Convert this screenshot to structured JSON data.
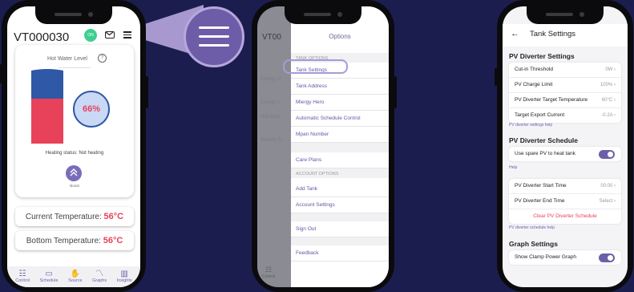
{
  "phone1": {
    "device_id": "VT000030",
    "avatar_text": "ON",
    "mail_icon": "mail-icon",
    "menu_icon": "hamburger-menu-icon",
    "hot_water_label": "Hot Water Level",
    "percentage": "66%",
    "hot_water_fraction": 0.66,
    "heating_status": "Heating status: Not heating",
    "boost_label": "Boost",
    "current_temp_label": "Current Temperature:",
    "current_temp_value": "56°C",
    "bottom_temp_label": "Bottom Temperature:",
    "bottom_temp_value": "56°C",
    "nav": [
      {
        "label": "Control",
        "icon": "sliders-icon"
      },
      {
        "label": "Schedule",
        "icon": "calendar-icon"
      },
      {
        "label": "Source",
        "icon": "hand-icon"
      },
      {
        "label": "Graphs",
        "icon": "line-graph-icon"
      },
      {
        "label": "Insights",
        "icon": "bar-chart-icon"
      }
    ]
  },
  "phone2": {
    "title": "Options",
    "bg_title": "VT00",
    "bg_items": [
      "Energy U",
      "Energy U",
      "Hot Wate",
      "Weekly Sc"
    ],
    "section1": "TANK OPTIONS",
    "tank_items": [
      "Tank Settings",
      "Tank Address",
      "Miergy Hero",
      "Automatic Schedule Control",
      "Mpan Number"
    ],
    "care_plans": "Care Plans",
    "section2": "ACCOUNT OPTIONS",
    "account_items": [
      "Add Tank",
      "Account Settings"
    ],
    "sign_out": "Sign Out",
    "feedback": "Feedback",
    "bg_nav_label": "Control"
  },
  "phone3": {
    "back_icon": "back-arrow-icon",
    "title": "Tank Settings",
    "section_pv": "PV Diverter Settings",
    "pv_rows": [
      {
        "label": "Cut-in Threshold",
        "value": "0W"
      },
      {
        "label": "PV Charge Limit",
        "value": "100%"
      },
      {
        "label": "PV Diverter Target Temperature",
        "value": "60°C"
      },
      {
        "label": "Target Export Current",
        "value": "-0.2A"
      }
    ],
    "pv_help": "PV diverter settings help",
    "section_schedule": "PV Diverter Schedule",
    "spare_pv_label": "Use spare PV to heat tank",
    "spare_pv_enabled": true,
    "help_link": "Help",
    "schedule_rows": [
      {
        "label": "PV Diverter Start Time",
        "value": "00:00"
      },
      {
        "label": "PV Diverter End Time",
        "value": "Select"
      }
    ],
    "clear_schedule": "Clear PV Diverter Schedule",
    "schedule_help": "PV diverter schedule help",
    "section_graph": "Graph Settings",
    "clamp_label": "Show Clamp Power Graph",
    "clamp_enabled": true
  },
  "colors": {
    "background": "#1c1d4f",
    "accent": "#6c5fa8",
    "hot": "#e8425a",
    "cold": "#2f58a6"
  }
}
